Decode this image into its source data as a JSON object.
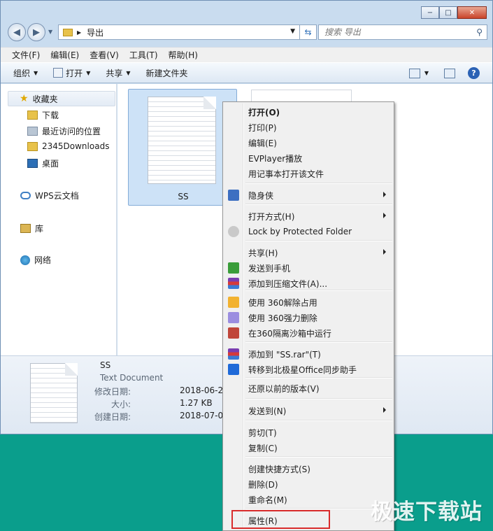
{
  "window": {
    "address": "导出",
    "search_placeholder": "搜索 导出",
    "controls": {
      "minimize": "−",
      "maximize": "□",
      "close": "✕"
    }
  },
  "menubar": [
    "文件(F)",
    "编辑(E)",
    "查看(V)",
    "工具(T)",
    "帮助(H)"
  ],
  "toolbar": {
    "organize": "组织",
    "open": "打开",
    "share": "共享",
    "new_folder": "新建文件夹"
  },
  "sidebar": {
    "favorites": "收藏夹",
    "fav_items": [
      "下载",
      "最近访问的位置",
      "2345Downloads",
      "桌面"
    ],
    "wps": "WPS云文档",
    "library": "库",
    "network": "网络"
  },
  "file": {
    "name": "SS"
  },
  "details": {
    "name": "SS",
    "type": "Text Document",
    "modified_label": "修改日期:",
    "modified": "2018-06-29",
    "size_label": "大小:",
    "size": "1.27 KB",
    "created_label": "创建日期:",
    "created": "2018-07-07"
  },
  "context_menu": [
    {
      "label": "打开(O)",
      "bold": true
    },
    {
      "label": "打印(P)"
    },
    {
      "label": "编辑(E)"
    },
    {
      "label": "EVPlayer播放"
    },
    {
      "label": "用记事本打开该文件"
    },
    {
      "label": "隐身侠",
      "submenu": true,
      "icon": "incognito-icon"
    },
    {
      "label": "打开方式(H)",
      "submenu": true
    },
    {
      "label": "Lock by Protected Folder",
      "icon": "lock-icon"
    },
    {
      "label": "共享(H)",
      "submenu": true
    },
    {
      "label": "发送到手机",
      "icon": "phone-send-icon"
    },
    {
      "label": "添加到压缩文件(A)...",
      "icon": "winrar-icon"
    },
    {
      "label": "使用 360解除占用",
      "icon": "unlock-360-icon"
    },
    {
      "label": "使用 360强力删除",
      "icon": "shred-360-icon"
    },
    {
      "label": "在360隔离沙箱中运行",
      "icon": "sandbox-360-icon"
    },
    {
      "label": "添加到 \"SS.rar\"(T)",
      "icon": "winrar-icon"
    },
    {
      "label": "转移到北极星Office同步助手",
      "icon": "office-sync-icon"
    },
    {
      "label": "还原以前的版本(V)"
    },
    {
      "label": "发送到(N)",
      "submenu": true
    },
    {
      "label": "剪切(T)"
    },
    {
      "label": "复制(C)"
    },
    {
      "label": "创建快捷方式(S)"
    },
    {
      "label": "删除(D)"
    },
    {
      "label": "重命名(M)"
    },
    {
      "label": "属性(R)"
    }
  ],
  "watermark": "极速下载站",
  "colors": {
    "accent": "#d92c2c",
    "desktop": "#0a9e8c",
    "selection": "#cde2f7"
  }
}
